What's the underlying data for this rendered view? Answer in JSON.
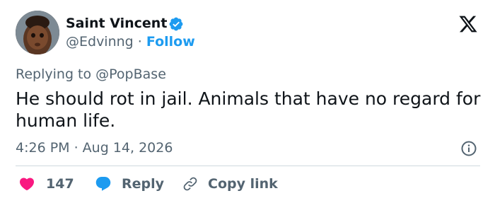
{
  "author": {
    "display_name": "Saint Vincent",
    "handle": "@Edvinng",
    "separator": "·",
    "follow_label": "Follow",
    "verified": true
  },
  "platform_icon": "x-logo-icon",
  "replying_to": "Replying to @PopBase",
  "tweet_text": "He should rot in jail. Animals that have no regard for human life.",
  "timestamp": "4:26 PM · Aug 14, 2026",
  "actions": {
    "like_count": "147",
    "reply_label": "Reply",
    "copy_link_label": "Copy link"
  },
  "colors": {
    "accent": "#1d9bf0",
    "like": "#f91880",
    "text": "#0f1419",
    "muted": "#536471",
    "divider": "#cfd9de"
  },
  "icons": [
    "avatar",
    "verified-badge-icon",
    "x-logo-icon",
    "info-icon",
    "heart-icon",
    "reply-bubble-icon",
    "link-icon"
  ]
}
